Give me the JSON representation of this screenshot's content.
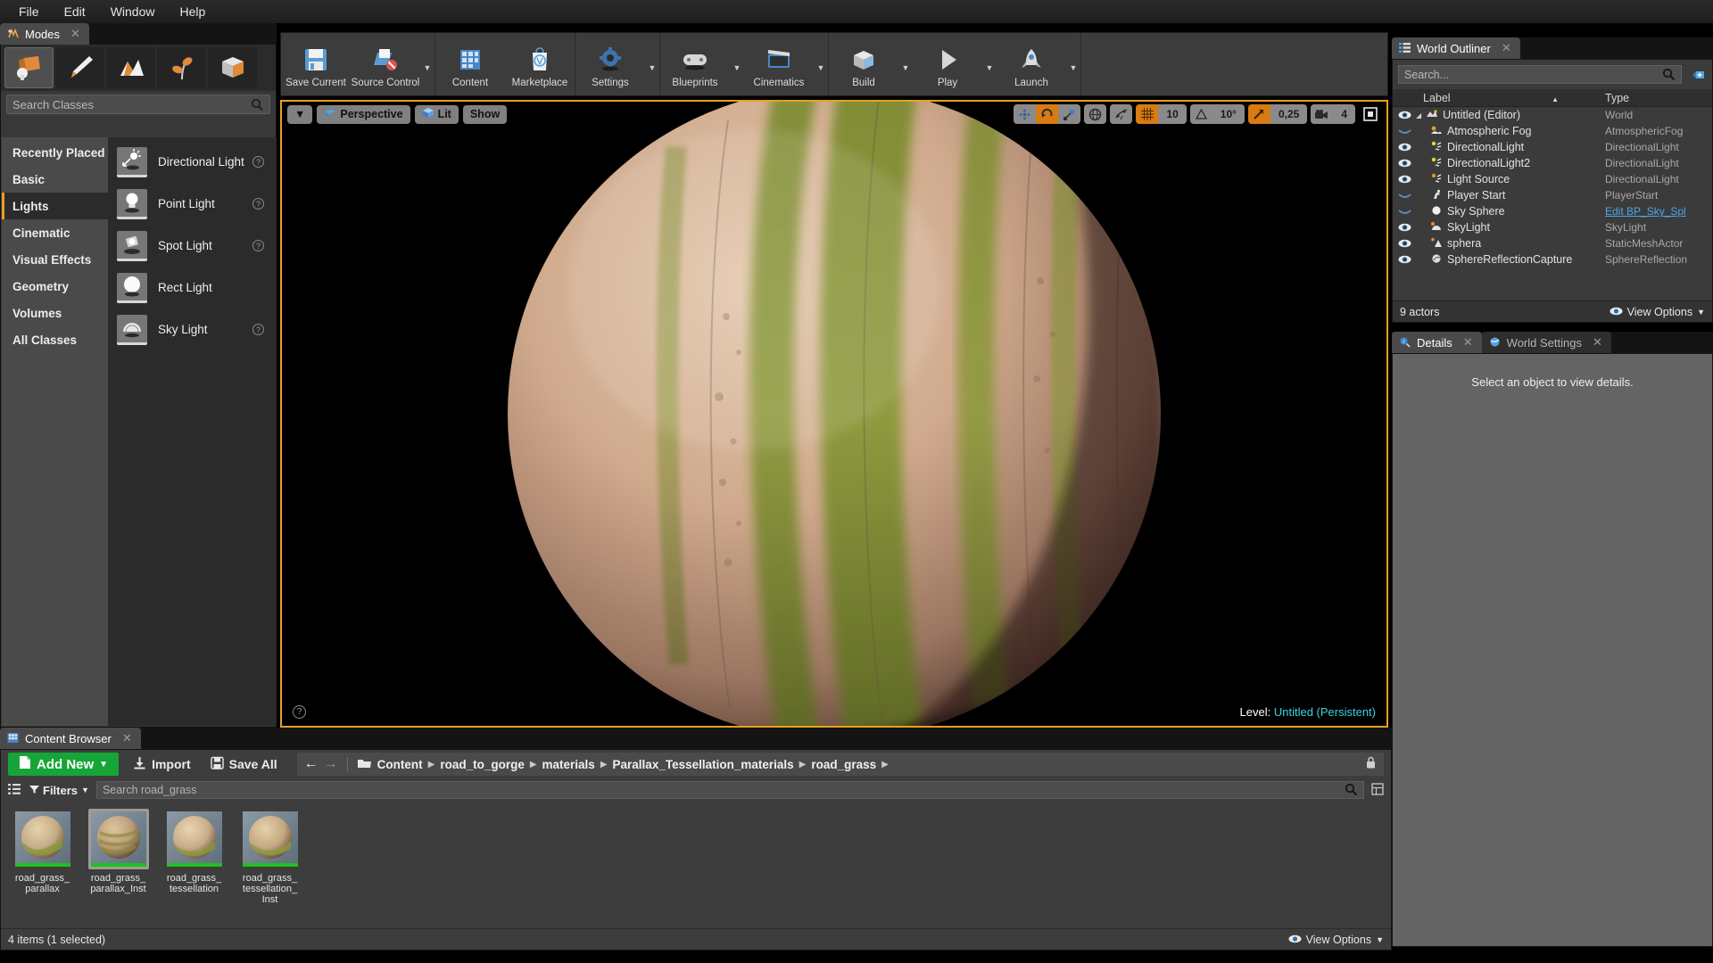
{
  "menubar": {
    "items": [
      {
        "label": "File",
        "name": "menu-file"
      },
      {
        "label": "Edit",
        "name": "menu-edit"
      },
      {
        "label": "Window",
        "name": "menu-window"
      },
      {
        "label": "Help",
        "name": "menu-help"
      }
    ]
  },
  "modes": {
    "tab_label": "Modes",
    "tab_icon": "modes-icon",
    "mode_buttons": [
      {
        "name": "place-mode",
        "icon": "place-cube-icon",
        "selected": true
      },
      {
        "name": "paint-mode",
        "icon": "paint-brush-icon",
        "selected": false
      },
      {
        "name": "landscape-mode",
        "icon": "landscape-mountain-icon",
        "selected": false
      },
      {
        "name": "foliage-mode",
        "icon": "foliage-leaf-icon",
        "selected": false
      },
      {
        "name": "geometry-editing-mode",
        "icon": "geometry-box-icon",
        "selected": false
      }
    ],
    "search_placeholder": "Search Classes",
    "categories": [
      {
        "label": "Recently Placed",
        "selected": false
      },
      {
        "label": "Basic",
        "selected": false
      },
      {
        "label": "Lights",
        "selected": true
      },
      {
        "label": "Cinematic",
        "selected": false
      },
      {
        "label": "Visual Effects",
        "selected": false
      },
      {
        "label": "Geometry",
        "selected": false
      },
      {
        "label": "Volumes",
        "selected": false
      },
      {
        "label": "All Classes",
        "selected": false
      }
    ],
    "classes": [
      {
        "label": "Directional Light",
        "icon": "directional-light-icon",
        "help": true
      },
      {
        "label": "Point Light",
        "icon": "point-light-icon",
        "help": true
      },
      {
        "label": "Spot Light",
        "icon": "spot-light-icon",
        "help": true
      },
      {
        "label": "Rect Light",
        "icon": "rect-light-icon",
        "help": false
      },
      {
        "label": "Sky Light",
        "icon": "sky-light-icon",
        "help": true
      }
    ]
  },
  "toolbar": {
    "groups": [
      {
        "items": [
          {
            "label": "Save Current",
            "icon": "save-floppy-icon",
            "caret": false
          },
          {
            "label": "Source Control",
            "icon": "source-control-icon",
            "caret": true
          }
        ]
      },
      {
        "items": [
          {
            "label": "Content",
            "icon": "content-grid-icon",
            "caret": false
          },
          {
            "label": "Marketplace",
            "icon": "marketplace-bag-icon",
            "caret": false
          }
        ]
      },
      {
        "items": [
          {
            "label": "Settings",
            "icon": "settings-gear-icon",
            "caret": true
          }
        ]
      },
      {
        "items": [
          {
            "label": "Blueprints",
            "icon": "blueprints-gamepad-icon",
            "caret": true
          },
          {
            "label": "Cinematics",
            "icon": "cinematics-clapper-icon",
            "caret": true
          }
        ]
      },
      {
        "items": [
          {
            "label": "Build",
            "icon": "build-box-icon",
            "caret": true
          },
          {
            "label": "Play",
            "icon": "play-triangle-icon",
            "caret": true
          },
          {
            "label": "Launch",
            "icon": "launch-rocket-icon",
            "caret": true
          }
        ]
      }
    ]
  },
  "viewport": {
    "view_menu_caret": "▼",
    "perspective_label": "Perspective",
    "lit_label": "Lit",
    "show_label": "Show",
    "transform_tools": [
      {
        "name": "translate-mode-button",
        "icon": "move-arrows-icon",
        "active": false
      },
      {
        "name": "rotate-mode-button",
        "icon": "rotate-arc-icon",
        "active": true
      },
      {
        "name": "scale-mode-button",
        "icon": "scale-box-icon",
        "active": false
      }
    ],
    "coord_system": {
      "name": "world-coordinate-button",
      "icon": "globe-icon",
      "active": false
    },
    "surface_snap": {
      "name": "surface-snap-button",
      "icon": "surface-snap-icon",
      "active": false
    },
    "grid_snap": {
      "name": "grid-snap-toggle",
      "icon": "grid-icon",
      "active": true
    },
    "grid_size": "10",
    "angle_snap": {
      "name": "angle-snap-toggle",
      "icon": "angle-triangle-icon",
      "active": false
    },
    "angle_size": "10°",
    "scale_snap": {
      "name": "scale-snap-toggle",
      "icon": "scale-arrow-icon",
      "active": true
    },
    "scale_size": "0,25",
    "camera_speed_icon": "camera-speed-icon",
    "camera_speed": "4",
    "maximize": {
      "name": "maximize-viewport-button",
      "icon": "maximize-icon"
    },
    "help_icon": "help-question-icon",
    "level_label": "Level:",
    "level_name": "Untitled (Persistent)",
    "level_color": "#3fd2e0"
  },
  "outliner": {
    "tab_label": "World Outliner",
    "tab_icon": "outliner-list-icon",
    "search_placeholder": "Search...",
    "search_icon": "search-icon",
    "add_icon": "add-column-icon",
    "columns": {
      "label": "Label",
      "type": "Type"
    },
    "sort_indicator": "▲",
    "rows": [
      {
        "label": "Untitled (Editor)",
        "type": "World",
        "icon": "world-icon",
        "indent": 0,
        "eye": "open",
        "expander": true,
        "link": false
      },
      {
        "label": "Atmospheric Fog",
        "type": "AtmosphericFog",
        "icon": "fog-icon",
        "indent": 1,
        "eye": "closed",
        "expander": false,
        "link": false
      },
      {
        "label": "DirectionalLight",
        "type": "DirectionalLight",
        "icon": "light-yellow-icon",
        "indent": 1,
        "eye": "open",
        "expander": false,
        "link": false
      },
      {
        "label": "DirectionalLight2",
        "type": "DirectionalLight",
        "icon": "light-yellow-icon",
        "indent": 1,
        "eye": "open",
        "expander": false,
        "link": false
      },
      {
        "label": "Light Source",
        "type": "DirectionalLight",
        "icon": "light-orange-icon",
        "indent": 1,
        "eye": "open",
        "expander": false,
        "link": false
      },
      {
        "label": "Player Start",
        "type": "PlayerStart",
        "icon": "player-start-icon",
        "indent": 1,
        "eye": "closed",
        "expander": false,
        "link": false
      },
      {
        "label": "Sky Sphere",
        "type": "Edit BP_Sky_Spl",
        "icon": "sky-sphere-icon",
        "indent": 1,
        "eye": "closed",
        "expander": false,
        "link": true
      },
      {
        "label": "SkyLight",
        "type": "SkyLight",
        "icon": "skylight-icon",
        "indent": 1,
        "eye": "open",
        "expander": false,
        "link": false
      },
      {
        "label": "sphera",
        "type": "StaticMeshActor",
        "icon": "static-mesh-icon",
        "indent": 1,
        "eye": "open",
        "expander": false,
        "link": false
      },
      {
        "label": "SphereReflectionCapture",
        "type": "SphereReflection",
        "icon": "reflection-capture-icon",
        "indent": 1,
        "eye": "open",
        "expander": false,
        "link": false
      }
    ],
    "footer_count": "9 actors",
    "view_options": "View Options",
    "view_options_icon": "eye-icon"
  },
  "details": {
    "tabs": [
      {
        "label": "Details",
        "icon": "details-magnifier-icon",
        "active": true
      },
      {
        "label": "World Settings",
        "icon": "world-settings-globe-icon",
        "active": false
      }
    ],
    "empty_message": "Select an object to view details."
  },
  "content_browser": {
    "tab_label": "Content Browser",
    "tab_icon": "content-browser-icon",
    "add_new": {
      "label": "Add New",
      "icon": "add-new-file-icon",
      "caret": "▼",
      "color": "#16a637"
    },
    "import": {
      "label": "Import",
      "icon": "import-icon"
    },
    "save_all": {
      "label": "Save All",
      "icon": "save-all-icon"
    },
    "nav_back_icon": "arrow-back-icon",
    "nav_forward_icon": "arrow-forward-icon",
    "folder_icon": "folder-icon",
    "breadcrumb": [
      "Content",
      "road_to_gorge",
      "materials",
      "Parallax_Tessellation_materials",
      "road_grass"
    ],
    "lock_icon": "lock-icon",
    "sources_icon": "sources-toggle-icon",
    "filters_label": "Filters",
    "filters_icon": "filter-funnel-icon",
    "search_placeholder": "Search road_grass",
    "search_icon": "search-icon",
    "settings_icon": "cb-settings-icon",
    "assets": [
      {
        "name": "road_grass_\nparallax",
        "line1": "road_grass_",
        "line2": "parallax",
        "selected": false,
        "type": "material"
      },
      {
        "name": "road_grass_\nparallax_Inst",
        "line1": "road_grass_",
        "line2": "parallax_Inst",
        "selected": true,
        "type": "material-instance"
      },
      {
        "name": "road_grass_\ntessellation",
        "line1": "road_grass_",
        "line2": "tessellation",
        "selected": false,
        "type": "material"
      },
      {
        "name": "road_grass_\ntessellation_Inst",
        "line1": "road_grass_",
        "line2": "tessellation_",
        "line3": "Inst",
        "selected": false,
        "type": "material-instance"
      }
    ],
    "footer_status": "4 items (1 selected)",
    "view_options": "View Options",
    "view_options_icon": "eye-icon"
  }
}
